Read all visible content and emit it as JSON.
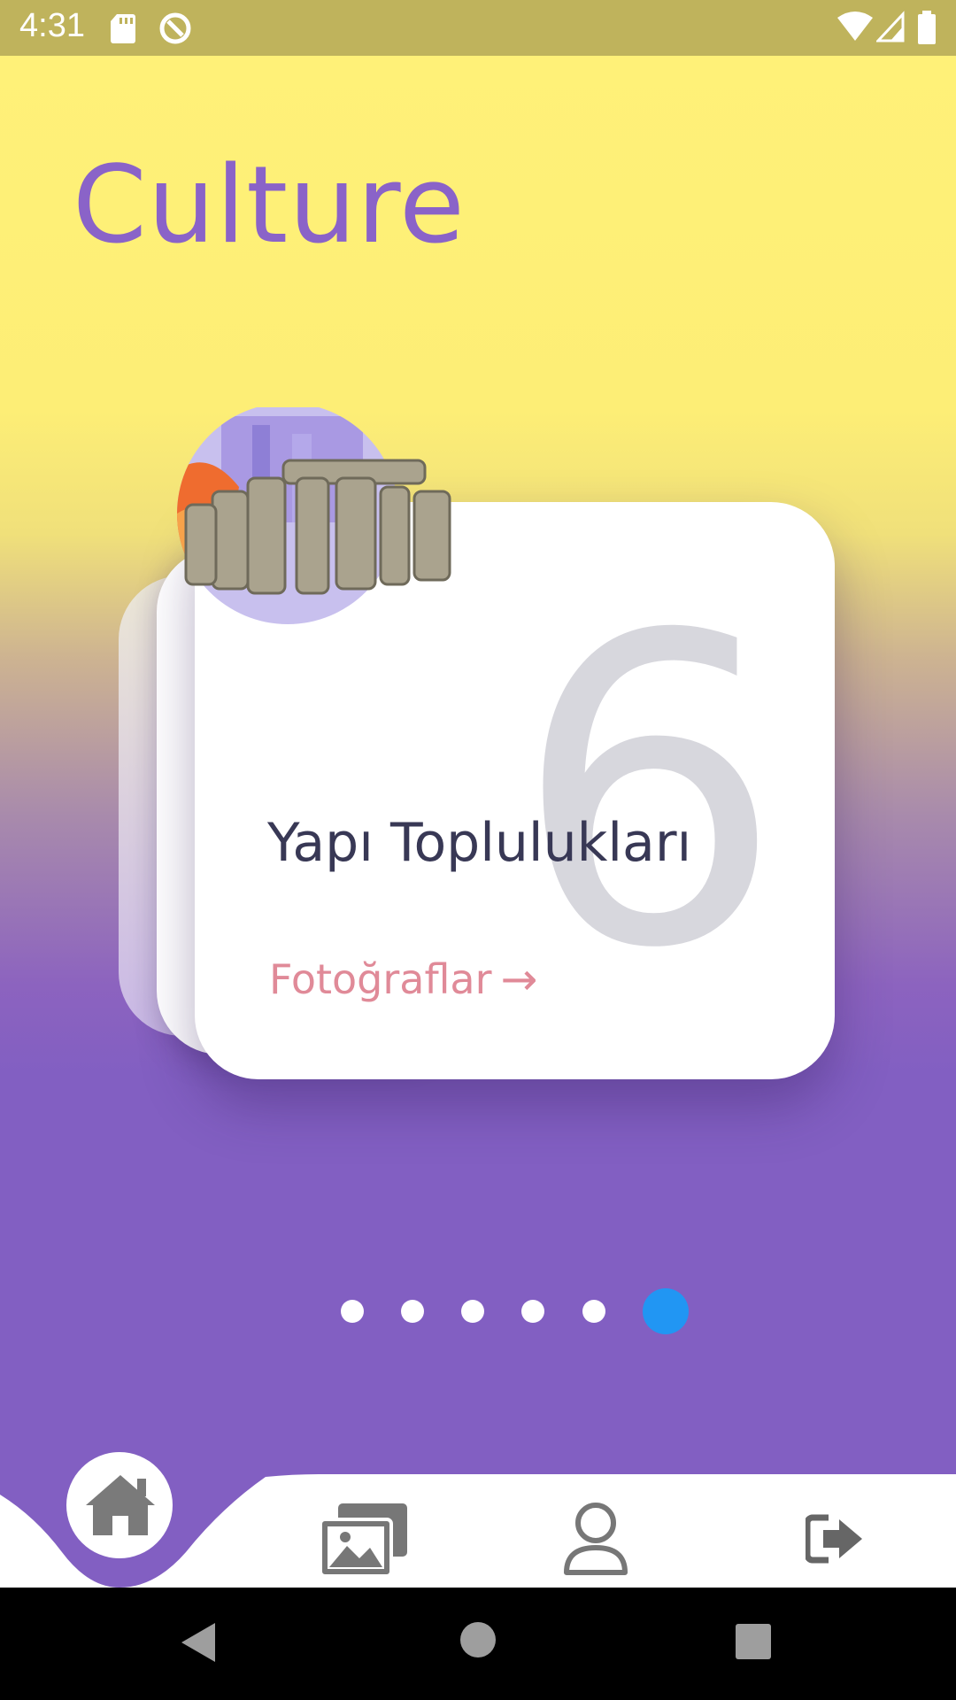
{
  "status_bar": {
    "time": "4:31",
    "icons": [
      "sd-card-icon",
      "sync-icon",
      "wifi-icon",
      "signal-icon",
      "battery-icon"
    ]
  },
  "page": {
    "title": "Culture"
  },
  "card": {
    "title": "Yapı Toplulukları",
    "number": "6",
    "link_label": "Fotoğraflar",
    "link_arrow": "→"
  },
  "pager": {
    "count": 6,
    "active_index": 5
  },
  "bottom_nav": {
    "items": [
      {
        "icon": "home-icon",
        "active": true
      },
      {
        "icon": "gallery-icon",
        "active": false
      },
      {
        "icon": "profile-icon",
        "active": false
      },
      {
        "icon": "logout-icon",
        "active": false
      }
    ]
  },
  "colors": {
    "title": "#8a63c8",
    "purple": "#825fc2",
    "yellow": "#fff178",
    "dot_active": "#2196f3",
    "link": "#e08a98",
    "icon_gray": "#6f6f6f"
  }
}
